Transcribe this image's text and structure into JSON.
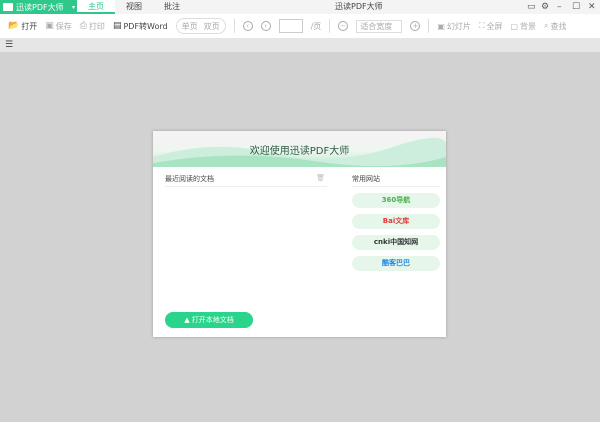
{
  "app": {
    "title": "迅读PDF大师",
    "window_title": "迅读PDF大师"
  },
  "tabs": [
    {
      "label": "主页",
      "active": true
    },
    {
      "label": "视图"
    },
    {
      "label": "批注"
    }
  ],
  "toolbar": {
    "open": "打开",
    "save": "保存",
    "print": "打印",
    "pdf2word": "PDF转Word",
    "single": "单页",
    "double": "双页",
    "page_suffix": "/页",
    "zoom_value": "适合宽度",
    "slideshow": "幻灯片",
    "fullscreen": "全屏",
    "background": "背景",
    "find": "查找"
  },
  "dialog": {
    "title": "欢迎使用迅读PDF大师",
    "recent_title": "最近阅读的文档",
    "sites_title": "常用网站",
    "sites": [
      {
        "label": "360导航",
        "color": "#4caf50"
      },
      {
        "label": "Bai文库",
        "color": "#e53935"
      },
      {
        "label": "cnki中国知网",
        "color": "#333333"
      },
      {
        "label": "酷客巴巴",
        "color": "#1e88e5"
      }
    ],
    "open_local": "打开本地文档"
  },
  "colors": {
    "accent": "#2fc88b"
  }
}
